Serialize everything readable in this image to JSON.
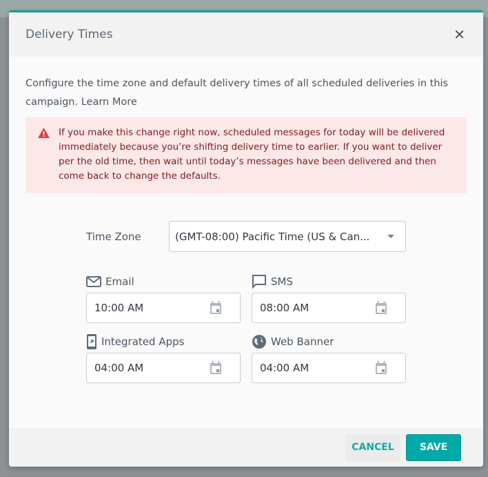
{
  "dialog": {
    "title": "Delivery Times",
    "close_icon": "close-icon"
  },
  "description": {
    "text": "Configure the time zone and default delivery times of all scheduled deliveries in this campaign.",
    "link": "Learn More"
  },
  "alert": {
    "icon": "warning-icon",
    "color": "#e53e3e",
    "text": "If you make this change right now, scheduled messages for today will be delivered immediately because you’re shifting delivery time to earlier. If you want to deliver per the old time, then wait until today’s messages have been delivered and then come back to change the defaults."
  },
  "timezone": {
    "label": "Time Zone",
    "value": "(GMT-08:00) Pacific Time (US & Can..."
  },
  "fields": [
    {
      "label": "Email",
      "icon": "envelope-icon",
      "value": "10:00 AM"
    },
    {
      "label": "SMS",
      "icon": "chat-bubble-icon",
      "value": "08:00 AM"
    },
    {
      "label": "Integrated Apps",
      "icon": "mobile-app-icon",
      "value": "04:00 AM"
    },
    {
      "label": "Web Banner",
      "icon": "globe-icon",
      "value": "04:00 AM"
    }
  ],
  "footer": {
    "cancel": "CANCEL",
    "save": "SAVE"
  },
  "colors": {
    "accent": "#02a9a8",
    "alert_bg": "#fde8e8"
  }
}
